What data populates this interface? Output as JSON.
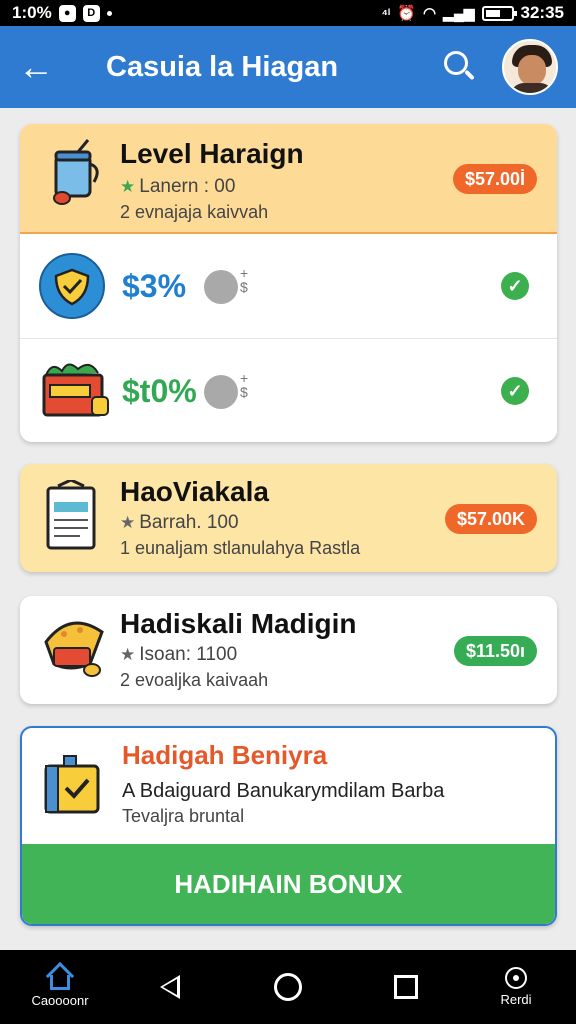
{
  "status_bar": {
    "left_text": "1:0%",
    "time": "32:35",
    "battery_level": 0.6
  },
  "app_bar": {
    "title": "Casuia la Hiagan",
    "icons": [
      "back-arrow-icon",
      "search-icon",
      "avatar"
    ]
  },
  "cards": [
    {
      "title": "Level Haraign",
      "meta": "Lanern : 00",
      "sub": "2 evnajaja kaivvah",
      "badge": "$57.00İ",
      "icon": "cup-icon",
      "rows": [
        {
          "percent": "$3%",
          "percent_color": "#1f7fd2",
          "icon": "shield-icon",
          "coin_mark": "+\n$"
        },
        {
          "percent": "$t0%",
          "percent_color": "#33a853",
          "icon": "gift-box-icon",
          "coin_mark": "+\n$"
        }
      ]
    },
    {
      "title": "HaoViakala",
      "meta": "Barrah. 100",
      "sub": "1 eunaljam stlanulahya Rastla",
      "badge": "$57.00K",
      "icon": "document-icon"
    },
    {
      "title": "Hadiskali Madigin",
      "meta": "Isoan: 1100",
      "sub": "2 evoaljka kaivaah",
      "badge": "$11.50ı",
      "icon": "pizza-icon"
    },
    {
      "title": "Hadigah Beniyra",
      "line1": "A Bdaiguard Banukarymdilam Barba",
      "line2": "Tevaljra bruntal",
      "button": "HADIHAIN BONUX",
      "icon": "checkbox-icon"
    }
  ],
  "nav_bar": {
    "home_label": "Caoooonr",
    "right_label": "Rerdi"
  },
  "colors": {
    "primary": "#2f7bd1",
    "accent_orange": "#f0672a",
    "accent_green": "#40b456"
  }
}
